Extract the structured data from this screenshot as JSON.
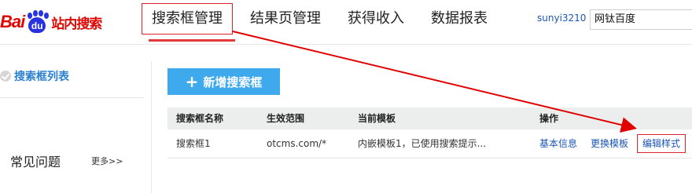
{
  "logo": {
    "brand_prefix": "Bai",
    "paw_text": "du",
    "site_name": "站内搜索"
  },
  "nav": {
    "items": [
      {
        "label": "搜索框管理",
        "active": true
      },
      {
        "label": "结果页管理",
        "active": false
      },
      {
        "label": "获得收入",
        "active": false
      },
      {
        "label": "数据报表",
        "active": false
      }
    ]
  },
  "user": {
    "name": "sunyi3210",
    "site": "网钛百度"
  },
  "sidebar": {
    "item_label": "搜索框列表",
    "faq_title": "常见问题",
    "faq_more": "更多>>"
  },
  "main": {
    "add_button_label": "新增搜索框",
    "table": {
      "headers": [
        "搜索框名称",
        "生效范围",
        "当前模板",
        "操作"
      ],
      "rows": [
        {
          "name": "搜索框1",
          "scope": "otcms.com/*",
          "template": "内嵌模板1，已使用搜索提示...",
          "actions": [
            "基本信息",
            "更换模板",
            "编辑样式"
          ]
        }
      ]
    }
  },
  "colors": {
    "accent_red": "#e4393c",
    "button_blue": "#3fa9ee",
    "link_blue": "#1a56b4",
    "annotation_arrow": "#e00000"
  }
}
